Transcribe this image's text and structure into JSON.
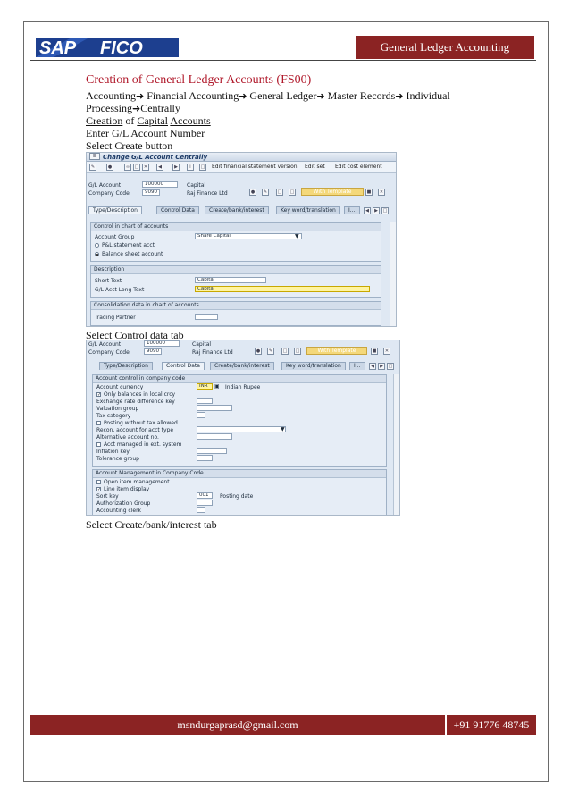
{
  "header": {
    "logo_text": "SAP FICO",
    "section_title": "General Ledger Accounting"
  },
  "doc": {
    "title": "Creation of General Ledger Accounts (FS00)",
    "path_parts": [
      "Accounting",
      "Financial Accounting",
      "General Ledger",
      "Master Records",
      "Individual",
      "Processing",
      "Centrally"
    ],
    "subheading_words": [
      "Creation",
      "of",
      "Capital",
      "Accounts"
    ],
    "step_enter": "Enter G/L Account Number",
    "step_create": "Select Create button",
    "step_control": "Select Control data tab",
    "step_bank": "Select Create/bank/interest tab"
  },
  "screen1": {
    "title": "Change G/L Account Centrally",
    "toolbar": [
      "Edit financial statement version",
      "Edit set",
      "Edit cost element"
    ],
    "gl_account_label": "G/L Account",
    "gl_account_value": "100000",
    "gl_account_desc": "Capital",
    "company_code_label": "Company Code",
    "company_code_value": "9090",
    "company_name": "Raj Finance Ltd",
    "with_template": "With Template",
    "tabs": [
      "Type/Description",
      "Control Data",
      "Create/bank/interest",
      "Key word/translation",
      "I..."
    ],
    "group_control": "Control in chart of accounts",
    "account_group_label": "Account Group",
    "account_group_value": "Share Capital",
    "radio_pl": "P&L statement acct",
    "radio_bs": "Balance sheet account",
    "group_description": "Description",
    "short_text_label": "Short Text",
    "short_text_value": "Capital",
    "long_text_label": "G/L Acct Long Text",
    "long_text_value": "Capital",
    "group_consolidation": "Consolidation data in chart of accounts",
    "trading_partner_label": "Trading Partner"
  },
  "screen2": {
    "gl_account_label": "G/L Account",
    "gl_account_value": "100000",
    "gl_account_desc": "Capital",
    "company_code_label": "Company Code",
    "company_code_value": "9090",
    "company_name": "Raj Finance Ltd",
    "with_template": "With Template",
    "tabs": [
      "Type/Description",
      "Control Data",
      "Create/bank/interest",
      "Key word/translation",
      "I..."
    ],
    "group_account_control": "Account control in company code",
    "account_currency_label": "Account currency",
    "account_currency_value": "INR",
    "account_currency_desc": "Indian Rupee",
    "only_balances_local": "Only balances in local crcy",
    "exchange_rate_diff": "Exchange rate difference key",
    "valuation_group": "Valuation group",
    "tax_category": "Tax category",
    "posting_without_tax": "Posting without tax allowed",
    "recon_account": "Recon. account for acct type",
    "alt_account": "Alternative account no.",
    "acct_managed_ext": "Acct managed in ext. system",
    "inflation_key": "Inflation key",
    "tolerance_group": "Tolerance group",
    "group_account_mgmt": "Account Management in Company Code",
    "open_item_mgmt": "Open item management",
    "line_item_display": "Line item display",
    "sort_key_label": "Sort key",
    "sort_key_value": "001",
    "sort_key_desc": "Posting date",
    "authorization_group": "Authorization Group",
    "accounting_clerk": "Accounting clerk"
  },
  "footer": {
    "email": "msndurgaprasd@gmail.com",
    "phone": "+91 91776 48745"
  },
  "colors": {
    "brand_red": "#8b2323",
    "title_red": "#b0182a",
    "sap_blue": "#1c3a66"
  }
}
